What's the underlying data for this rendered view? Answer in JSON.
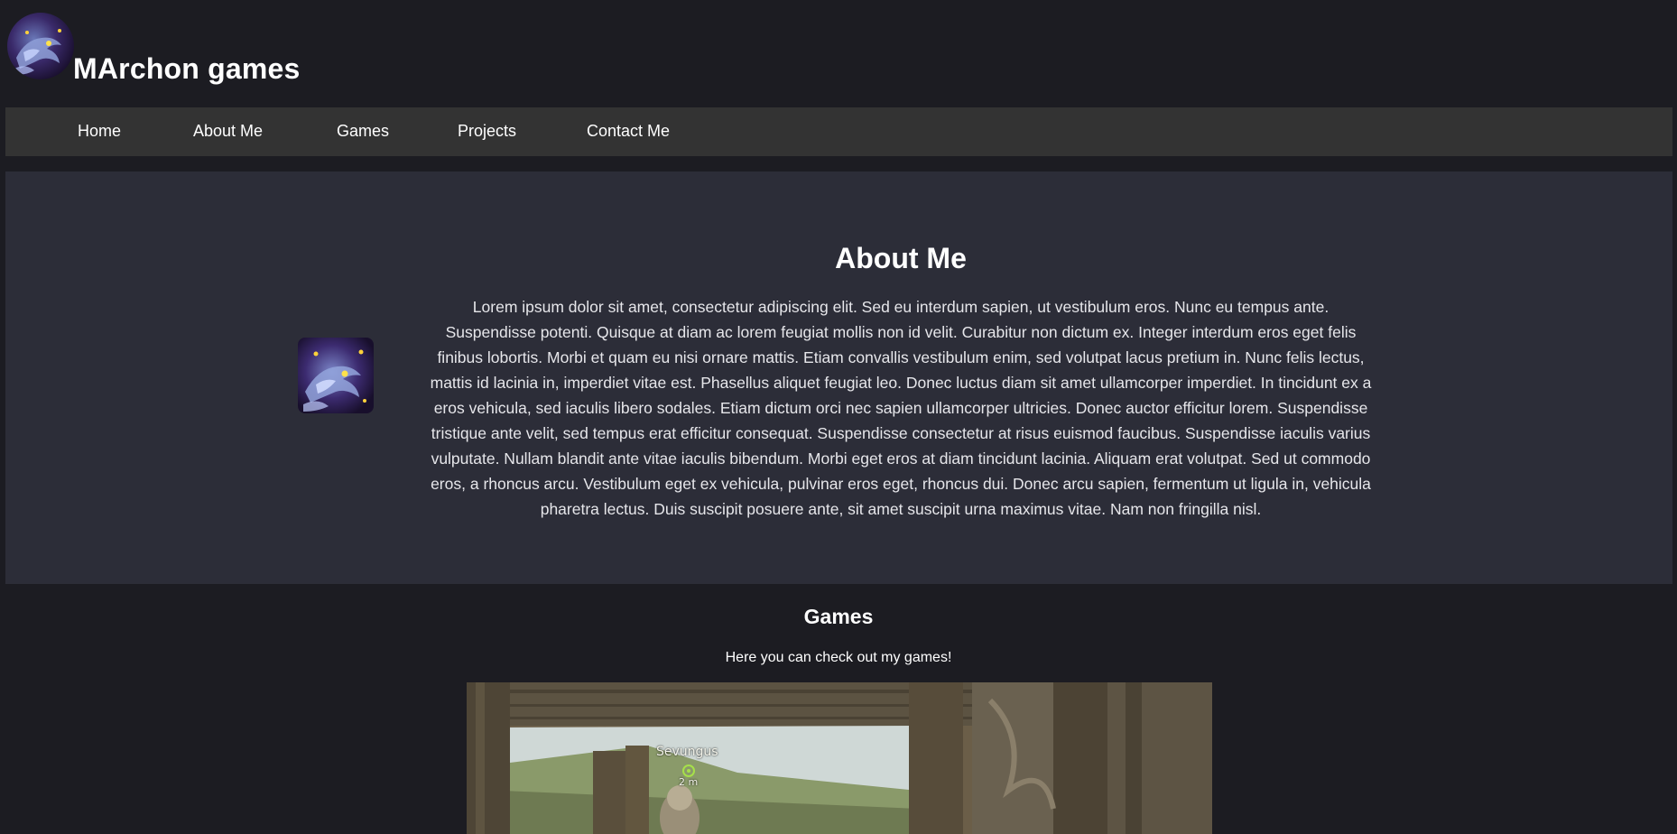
{
  "header": {
    "logo_icon": "dragon-logo-icon",
    "title": "MArchon games"
  },
  "nav": {
    "items": [
      {
        "label": "Home"
      },
      {
        "label": "About Me"
      },
      {
        "label": "Games"
      },
      {
        "label": "Projects"
      },
      {
        "label": "Contact Me"
      }
    ]
  },
  "about": {
    "image_icon": "dragon-avatar-icon",
    "title": "About Me",
    "text": "Lorem ipsum dolor sit amet, consectetur adipiscing elit. Sed eu interdum sapien, ut vestibulum eros. Nunc eu tempus ante. Suspendisse potenti. Quisque at diam ac lorem feugiat mollis non id velit. Curabitur non dictum ex. Integer interdum eros eget felis finibus lobortis. Morbi et quam eu nisi ornare mattis. Etiam convallis vestibulum enim, sed volutpat lacus pretium in. Nunc felis lectus, mattis id lacinia in, imperdiet vitae est. Phasellus aliquet feugiat leo. Donec luctus diam sit amet ullamcorper imperdiet. In tincidunt ex a eros vehicula, sed iaculis libero sodales. Etiam dictum orci nec sapien ullamcorper ultricies. Donec auctor efficitur lorem. Suspendisse tristique ante velit, sed tempus erat efficitur consequat. Suspendisse consectetur at risus euismod faucibus. Suspendisse iaculis varius vulputate. Nullam blandit ante vitae iaculis bibendum. Morbi eget eros at diam tincidunt lacinia. Aliquam erat volutpat. Sed ut commodo eros, a rhoncus arcu. Vestibulum eget ex vehicula, pulvinar eros eget, rhoncus dui. Donec arcu sapien, fermentum ut ligula in, vehicula pharetra lectus. Duis suscipit posuere ante, sit amet suscipit urna maximus vitae. Nam non fringilla nisl."
  },
  "games": {
    "title": "Games",
    "subtitle": "Here you can check out my games!",
    "screenshot": {
      "player_name": "Sevungus",
      "distance": "2 m"
    }
  },
  "colors": {
    "page_bg": "#1c1c22",
    "nav_bg": "#333333",
    "about_bg": "#2c2d38",
    "text": "#ffffff"
  }
}
